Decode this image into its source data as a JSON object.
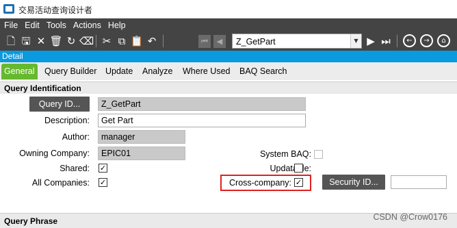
{
  "window": {
    "title": "交易活动查询设计者"
  },
  "menu": [
    "File",
    "Edit",
    "Tools",
    "Actions",
    "Help"
  ],
  "toolbar": {
    "icons": [
      "new-icon",
      "save-icon",
      "delete-icon",
      "trash-icon",
      "refresh-icon",
      "clear-icon",
      "cut-icon",
      "copy-icon",
      "paste-icon",
      "undo-icon",
      "first-record-icon",
      "previous-record-icon",
      "next-record-icon",
      "last-record-icon",
      "back-icon",
      "forward-icon",
      "home-icon"
    ],
    "query_combo_value": "Z_GetPart"
  },
  "detail_bar": {
    "label": "Detail"
  },
  "tabs": [
    {
      "label": "General",
      "active": true
    },
    {
      "label": "Query Builder",
      "active": false
    },
    {
      "label": "Update",
      "active": false
    },
    {
      "label": "Analyze",
      "active": false
    },
    {
      "label": "Where Used",
      "active": false
    },
    {
      "label": "BAQ Search",
      "active": false
    }
  ],
  "query_identification": {
    "header": "Query Identification",
    "query_id_button": "Query ID...",
    "query_id_value": "Z_GetPart",
    "description_label": "Description:",
    "description_value": "Get Part",
    "author_label": "Author:",
    "author_value": "manager",
    "owning_company_label": "Owning Company:",
    "owning_company_value": "EPIC01",
    "system_baq_label": "System BAQ:",
    "system_baq_checked": false,
    "shared_label": "Shared:",
    "shared_checked": true,
    "updatable_label": "Updatable:",
    "updatable_checked": false,
    "all_companies_label": "All Companies:",
    "all_companies_checked": true,
    "cross_company_label": "Cross-company:",
    "cross_company_checked": true,
    "security_id_button": "Security ID...",
    "security_id_value": "",
    "check_mark": "✓"
  },
  "query_phrase": {
    "header": "Query Phrase"
  },
  "watermark": "CSDN @Crow0176",
  "colors": {
    "accent": "#0a9ae0",
    "tab_active": "#66b82e",
    "toolbar": "#444444",
    "highlight": "#e02020"
  }
}
